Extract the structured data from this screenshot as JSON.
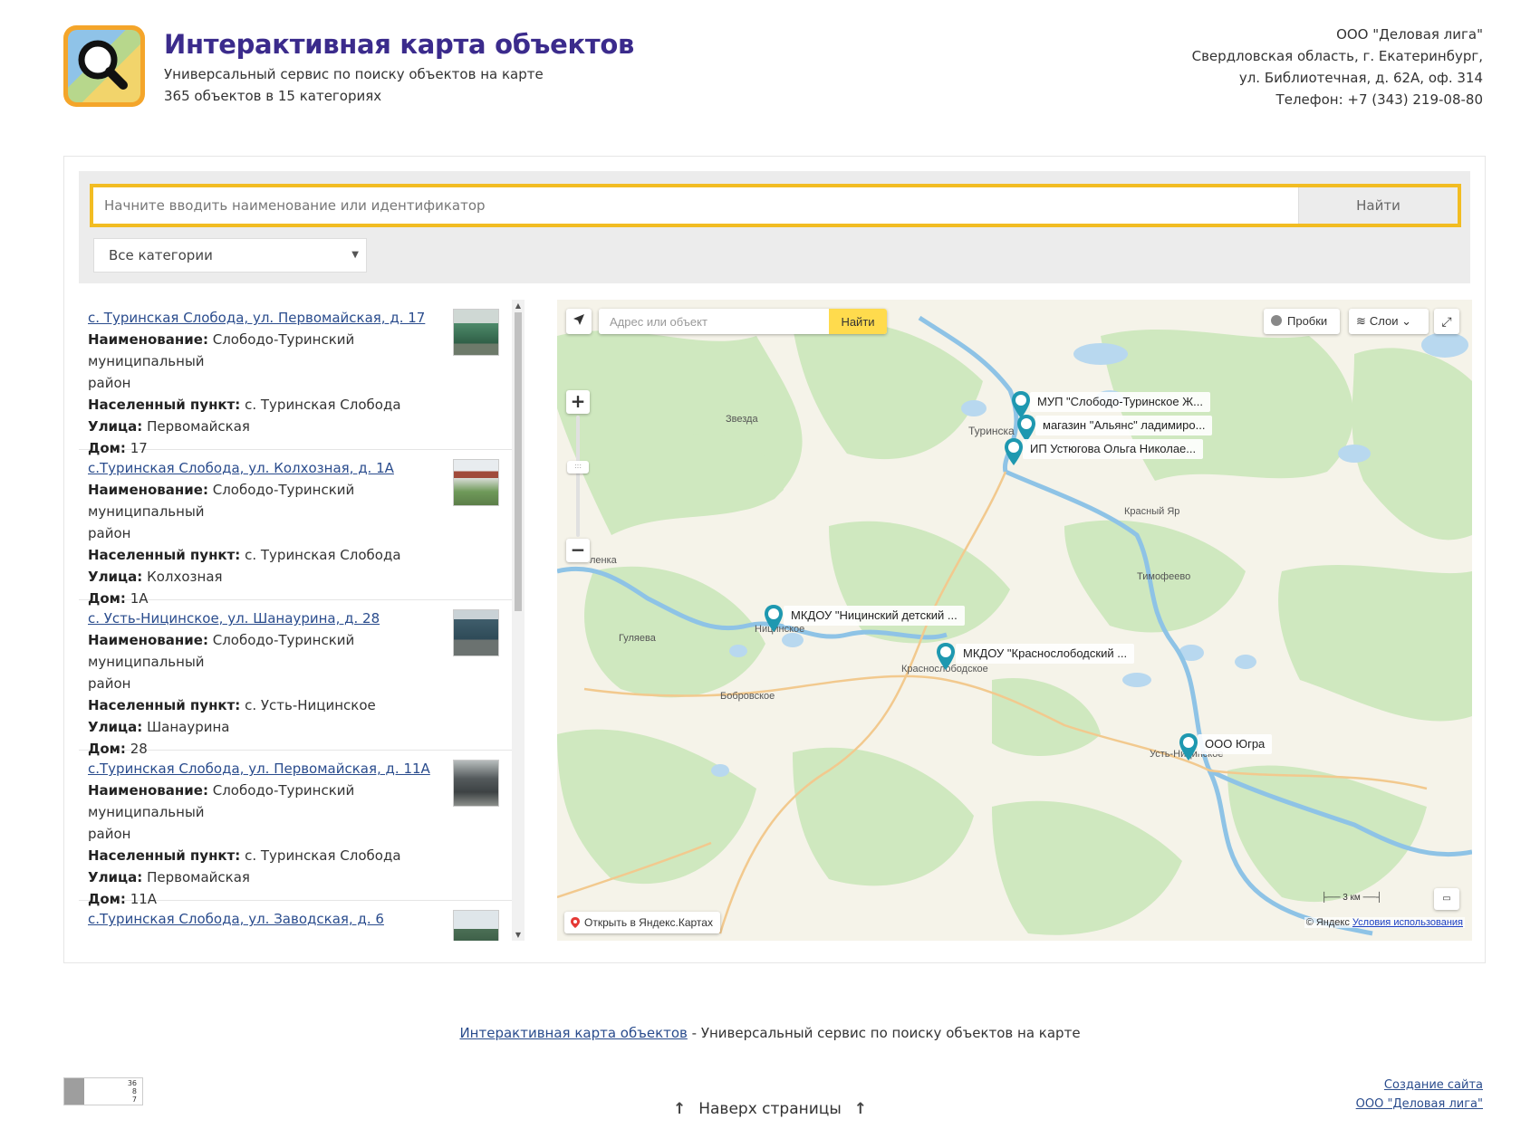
{
  "header": {
    "title": "Интерактивная карта объектов",
    "subtitle": "Универсальный сервис по поиску объектов на карте",
    "count_text": "365 объектов в 15 категориях"
  },
  "contact": {
    "company": "ООО \"Деловая лига\"",
    "address_line1": "Свердловская область, г. Екатеринбург,",
    "address_line2": "ул. Библиотечная, д. 62А, оф. 314",
    "phone": "Телефон: +7 (343) 219-08-80"
  },
  "search": {
    "placeholder": "Начните вводить наименование или идентификатор",
    "value": "",
    "button_label": "Найти",
    "category_selected": "Все категории"
  },
  "list": {
    "labels": {
      "name": "Наименование:",
      "locality": "Населенный пункт:",
      "street": "Улица:",
      "house": "Дом:"
    },
    "items": [
      {
        "link": "с. Туринская Слобода, ул. Первомайская, д. 17",
        "name": "Слободо-Туринский муниципальный",
        "name_cont": "район",
        "locality": "с. Туринская Слобода",
        "street": "Первомайская",
        "house": "17"
      },
      {
        "link": "с.Туринская Слобода, ул. Колхозная, д. 1А",
        "name": "Слободо-Туринский муниципальный",
        "name_cont": "район",
        "locality": "с. Туринская Слобода",
        "street": "Колхозная",
        "house": "1А"
      },
      {
        "link": "с. Усть-Ницинское, ул. Шанаурина, д. 28",
        "name": "Слободо-Туринский муниципальный",
        "name_cont": "район",
        "locality": "с. Усть-Ницинское",
        "street": "Шанаурина",
        "house": "28"
      },
      {
        "link": "с.Туринская Слобода, ул. Первомайская, д. 11А",
        "name": "Слободо-Туринский муниципальный",
        "name_cont": "район",
        "locality": "с. Туринская Слобода",
        "street": "Первомайская",
        "house": "11А"
      },
      {
        "link": "с.Туринская Слобода, ул. Заводская, д. 6"
      }
    ]
  },
  "map": {
    "address_placeholder": "Адрес или объект",
    "find_label": "Найти",
    "traffic_label": "Пробки",
    "layers_label": "Слои",
    "open_link": "Открыть в Яндекс.Картах",
    "scale": "3 км",
    "copyright_prefix": "© Яндекс",
    "terms_link": "Условия использования",
    "places": {
      "zvezda": "Звезда",
      "turinskaya": "Туринска",
      "krasny_yar": "Красный Яр",
      "timofeevo": "Тимофеево",
      "lenka": "ленка",
      "nitsinskoe": "Ницинское",
      "gulyaeva": "Гуляева",
      "krasnoslobodskoe": "Краснослободское",
      "bobrovskoe": "Бобровское",
      "ust_nitsinskoe": "Усть-Ницинское"
    },
    "markers": [
      "МУП \"Слободо-Туринское Ж...",
      "магазин \"Альянс\" ладимиро...",
      "ИП Устюгова Ольга Николае...",
      "МКДОУ \"Ницинский детский ...",
      "МКДОУ \"Краснослободский ...",
      "ООО Югра"
    ],
    "colors": {
      "marker": "#1e98b0",
      "find_button": "#ffdb4d"
    }
  },
  "footer": {
    "link": "Интерактивная карта объектов",
    "rest": " - Универсальный сервис по поиску объектов на карте",
    "to_top": "Наверх страницы",
    "credit1": "Создание сайта",
    "credit2": "ООО \"Деловая лига\"",
    "counter": [
      "36",
      "8",
      "7"
    ]
  },
  "colors": {
    "title": "#3b2b8c",
    "search_border": "#f2bc22"
  }
}
